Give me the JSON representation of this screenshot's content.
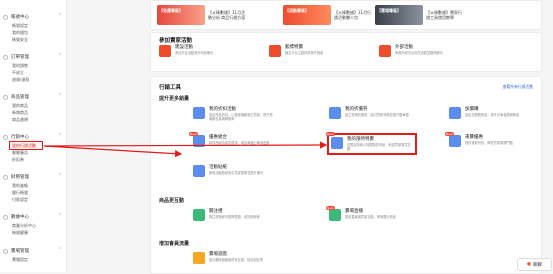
{
  "sidebar": {
    "sections": [
      {
        "title": "帳號中心",
        "items": [
          "帳號設定",
          "我的錢包",
          "帳號安全"
        ]
      },
      {
        "title": "訂單管理",
        "items": [
          "我的銷售",
          "不成立",
          "退貨/退款"
        ]
      },
      {
        "title": "商品管理",
        "items": [
          "我的商品",
          "新增商品",
          "商品違規"
        ]
      },
      {
        "title": "行銷中心",
        "items": [
          "我的行銷活動",
          "聊聊廣告",
          "折扣券"
        ]
      },
      {
        "title": "財務管理",
        "items": [
          "我的進帳",
          "銀行帳號",
          "付款設定"
        ]
      },
      {
        "title": "數據中心",
        "items": [
          "商業分析中心",
          "帳號健康"
        ]
      },
      {
        "title": "賣場管理",
        "items": [
          "賣場設定"
        ]
      }
    ]
  },
  "banners": [
    {
      "title": "【免運專區】",
      "text": "【乂棒數據】11月活動分析 商品行銷方案"
    },
    {
      "title": "【活動專區】",
      "text": "【乂棒數據】11月行銷活動懶人包"
    },
    {
      "title": "【賣場專區】",
      "text": "【乂棒數據】賣家行銷工具使用教學"
    }
  ],
  "activities": {
    "title": "參加賣家活動",
    "items": [
      {
        "name": "建設活動",
        "desc": "參加平台活動提升商品曝光"
      },
      {
        "name": "藍標特賣",
        "desc": "報名平台主題特賣提升銷量"
      },
      {
        "name": "外部活動",
        "desc": "參與外部平台合作活動並獲得曝光"
      }
    ]
  },
  "tools": {
    "title": "行銷工具",
    "more": "查看所有行銷活動",
    "sub1": "提升更多銷量",
    "sub2": "商品更互動",
    "sub3": "增加會員流量",
    "items": [
      {
        "name": "我的折扣活動",
        "desc": "設定商品折扣，以優惠價格吸引買家，提升賣場銷售量與轉換率"
      },
      {
        "name": "我的折價券",
        "desc": "建立賣場折價券，吸引買家消費並提升客單價"
      },
      {
        "name": "加價購",
        "desc": "設定加價購商品，提升訂單金額與銷量"
      },
      {
        "name": "優惠組合",
        "desc": "將商品組合設定優惠，增加單筆訂單商品數"
      },
      {
        "name": "我的限時特賣",
        "desc": "在限定時段以特價販售商品，刺激買家購買意願"
      },
      {
        "name": "運費優惠",
        "desc": "提供運費折抵，降低買家購物門檻"
      },
      {
        "name": "活動貼紙",
        "desc": "使用活動貼紙吸引買家點擊並提升曝光"
      },
      {
        "name": "關注禮",
        "desc": "關注賣場即可獲得優惠，增加粉絲數"
      },
      {
        "name": "賣場直播",
        "desc": "透過直播與買家互動，即時展示商品"
      },
      {
        "name": "賣場遊戲",
        "desc": "設計趣味遊戲與買家互動，增加回訪率"
      }
    ]
  },
  "badges": {
    "new": "New"
  },
  "float_button": "聊聊"
}
